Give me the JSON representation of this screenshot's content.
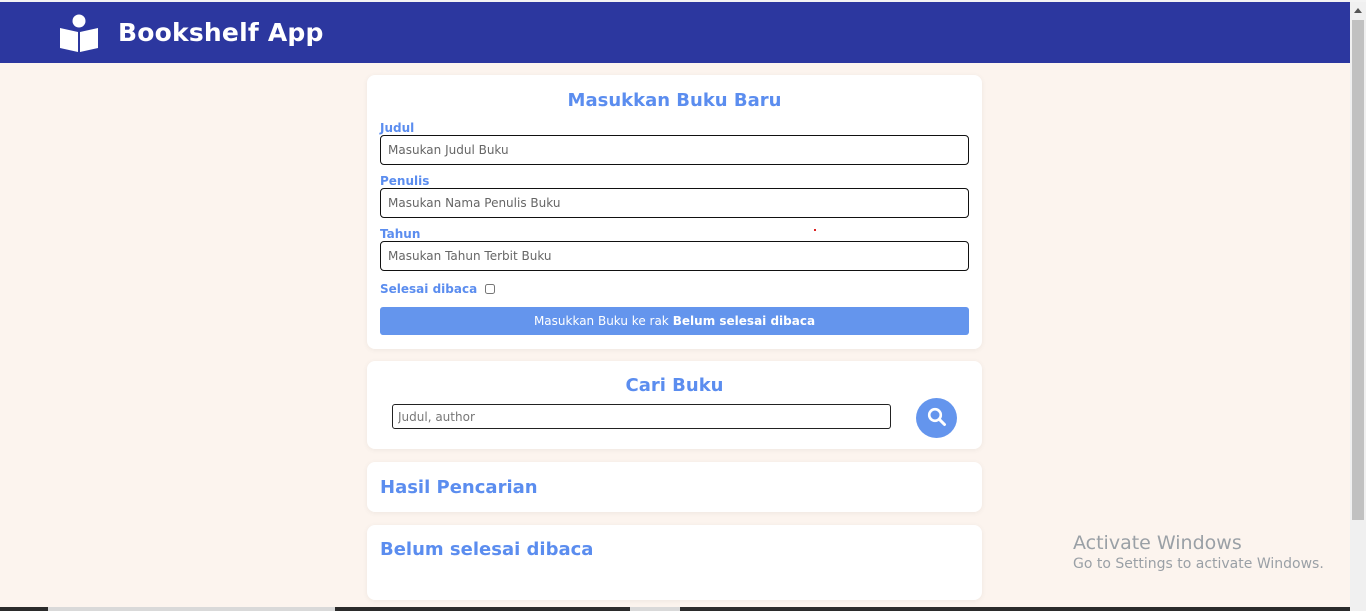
{
  "header": {
    "app_title": "Bookshelf App",
    "logo_icon": "reader-book-icon",
    "bg_color": "#2c379f"
  },
  "input_section": {
    "title": "Masukkan Buku Baru",
    "fields": [
      {
        "label": "Judul",
        "placeholder": "Masukan Judul Buku"
      },
      {
        "label": "Penulis",
        "placeholder": "Masukan Nama Penulis Buku"
      },
      {
        "label": "Tahun",
        "placeholder": "Masukan Tahun Terbit Buku"
      }
    ],
    "checkbox_label": "Selesai dibaca",
    "checkbox_checked": false,
    "submit_prefix": "Masukkan Buku ke rak",
    "submit_shelf": "Belum selesai dibaca",
    "accent_color": "#6495ed"
  },
  "search_section": {
    "title": "Cari Buku",
    "placeholder": "Judul, author",
    "button_icon": "search-icon"
  },
  "results_section": {
    "title": "Hasil Pencarian"
  },
  "unread_section": {
    "title": "Belum selesai dibaca"
  },
  "watermark": {
    "line1": "Activate Windows",
    "line2": "Go to Settings to activate Windows."
  }
}
